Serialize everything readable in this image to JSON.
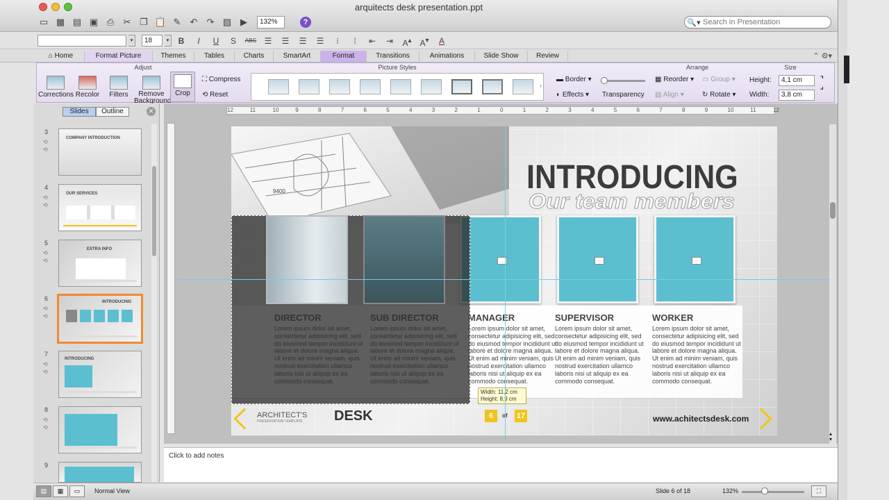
{
  "window": {
    "title": "arquitects desk presentation.ppt"
  },
  "toolbar": {
    "zoom": "132%",
    "help": "?"
  },
  "search": {
    "placeholder": "Search in Presentation"
  },
  "formatbar": {
    "font_size": "18",
    "buttons": [
      "B",
      "I",
      "U",
      "S",
      "ABC"
    ]
  },
  "tabs": [
    "Home",
    "Format Picture",
    "Themes",
    "Tables",
    "Charts",
    "SmartArt",
    "Format",
    "Transitions",
    "Animations",
    "Slide Show",
    "Review"
  ],
  "ribbon": {
    "groups": {
      "adjust": "Adjust",
      "picture_styles": "Picture Styles",
      "arrange": "Arrange",
      "size": "Size"
    },
    "adjust": [
      "Corrections",
      "Recolor",
      "Filters",
      "Remove Background",
      "Crop"
    ],
    "compress": "Compress",
    "reset": "Reset",
    "border": "Border",
    "effects": "Effects",
    "transparency": "Transparency",
    "reorder": "Reorder",
    "group": "Group",
    "align": "Align",
    "rotate": "Rotate",
    "height_label": "Height:",
    "width_label": "Width:",
    "height_value": "4,1 cm",
    "width_value": "3,8 cm"
  },
  "left_panel": {
    "tabs": [
      "Slides",
      "Outline"
    ],
    "slides": [
      {
        "num": "3",
        "title": "COMPANY INTRODUCTION",
        "selected": false
      },
      {
        "num": "4",
        "title": "OUR SERVICES",
        "selected": false
      },
      {
        "num": "5",
        "title": "EXTRA INFO",
        "selected": false
      },
      {
        "num": "6",
        "title": "INTRODUCING",
        "selected": true
      },
      {
        "num": "7",
        "title": "INTRODUCING",
        "selected": false
      },
      {
        "num": "8",
        "title": "",
        "selected": false
      },
      {
        "num": "9",
        "title": "",
        "selected": false
      }
    ]
  },
  "ruler": {
    "labels": [
      "12",
      "11",
      "10",
      "9",
      "8",
      "7",
      "6",
      "5",
      "4",
      "3",
      "2",
      "1",
      "0",
      "1",
      "2",
      "3",
      "4",
      "5",
      "6",
      "7",
      "8",
      "9",
      "10",
      "11",
      "12"
    ]
  },
  "slide": {
    "title": "INTRODUCING",
    "subtitle": "Our team members",
    "members": [
      {
        "role": "DIRECTOR",
        "desc": "Lorem ipsum dolor sit amet, consectetur adipisicing elit, sed do eiusmod tempor incididunt ut labore et dolore magna aliqua. Ut enim ad minim veniam, quis nostrud exercitation ullamco laboris nisi ut aliquip ex ea commodo consequat."
      },
      {
        "role": "SUB DIRECTOR",
        "desc": "Lorem ipsum dolor sit amet, consectetur adipisicing elit, sed do eiusmod tempor incididunt ut labore et dolore magna aliqua. Ut enim ad minim veniam, quis nostrud exercitation ullamco laboris nisi ut aliquip ex ea commodo consequat."
      },
      {
        "role": "MANAGER",
        "desc": "Lorem ipsum dolor sit amet, consectetur adipisicing elit, sed do eiusmod tempor incididunt ut labore et dolore magna aliqua. Ut enim ad minim veniam, quis nostrud exercitation ullamco laboris nisi ut aliquip ex ea commodo consequat."
      },
      {
        "role": "SUPERVISOR",
        "desc": "Lorem ipsum dolor sit amet, consectetur adipisicing elit, sed do eiusmod tempor incididunt ut labore et dolore magna aliqua. Ut enim ad minim veniam, quis nostrud exercitation ullamco laboris nisi ut aliquip ex ea commodo consequat."
      },
      {
        "role": "WORKER",
        "desc": "Lorem ipsum dolor sit amet, consectetur adipisicing elit, sed do eiusmod tempor incididunt ut labore et dolore magna aliqua. Ut enim ad minim veniam, quis nostrud exercitation ullamco laboris nisi ut aliquip ex ea commodo consequat."
      }
    ],
    "tooltip": {
      "width": "Width: 11,2 cm",
      "height": "Height: 8,9 cm"
    },
    "brand_top": "ARCHITECT'S",
    "brand_sub": "PRESENTATION TEMPLATE",
    "brand_desk": "DESK",
    "page_current": "6",
    "page_of": "of",
    "page_total": "17",
    "url": "www.achitectsdesk.com",
    "blueprint_number": "9400"
  },
  "notes": {
    "placeholder": "Click to add notes"
  },
  "status": {
    "view": "Normal View",
    "slide": "Slide 6 of 18",
    "zoom": "132%"
  },
  "colors": {
    "accent_yellow": "#f1c418",
    "photo_teal": "#5cbfd0",
    "format_tab": "#c9b3ea",
    "selected_slide": "#f08a2c"
  }
}
